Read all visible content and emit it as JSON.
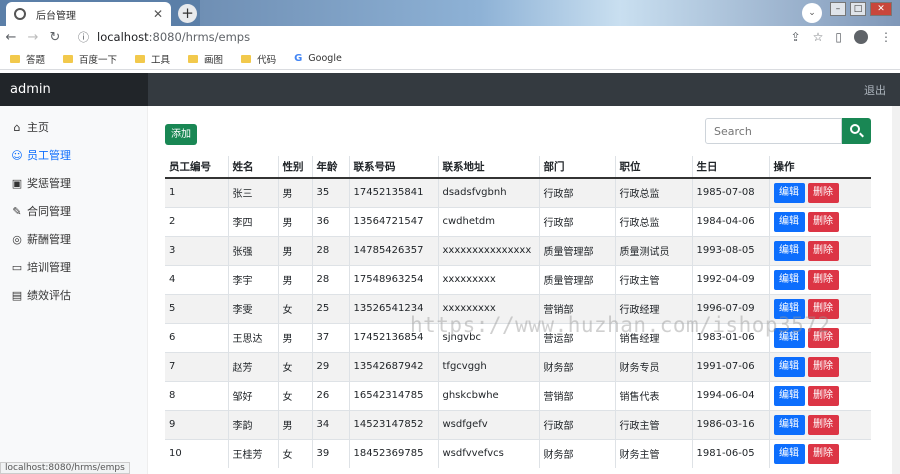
{
  "browser": {
    "tab_title": "后台管理",
    "tab_close": "✕",
    "new_tab": "+",
    "url_host": "localhost",
    "url_path": ":8080/hrms/emps",
    "bookmarks": [
      {
        "label": "答题",
        "icon": "folder-icon"
      },
      {
        "label": "百度一下",
        "icon": "folder-icon"
      },
      {
        "label": "工具",
        "icon": "folder-icon"
      },
      {
        "label": "画图",
        "icon": "folder-icon"
      },
      {
        "label": "代码",
        "icon": "folder-icon"
      },
      {
        "label": "Google",
        "icon": "google-icon"
      }
    ],
    "status_url": "localhost:8080/hrms/emps"
  },
  "navbar": {
    "brand": "admin",
    "logout": "退出"
  },
  "sidebar": {
    "items": [
      {
        "label": "主页",
        "icon": "home-icon",
        "glyph": "⌂"
      },
      {
        "label": "员工管理",
        "icon": "user-icon",
        "glyph": "☺"
      },
      {
        "label": "奖惩管理",
        "icon": "card-icon",
        "glyph": "▣"
      },
      {
        "label": "合同管理",
        "icon": "contract-icon",
        "glyph": "✎"
      },
      {
        "label": "薪酬管理",
        "icon": "money-icon",
        "glyph": "◎"
      },
      {
        "label": "培训管理",
        "icon": "training-icon",
        "glyph": "▭"
      },
      {
        "label": "绩效评估",
        "icon": "report-icon",
        "glyph": "▤"
      }
    ],
    "active_index": 1
  },
  "main": {
    "add_label": "添加",
    "search_placeholder": "Search",
    "columns": [
      "员工编号",
      "姓名",
      "性别",
      "年龄",
      "联系号码",
      "联系地址",
      "部门",
      "职位",
      "生日",
      "操作"
    ],
    "edit_label": "编辑",
    "delete_label": "删除",
    "rows": [
      [
        "1",
        "张三",
        "男",
        "35",
        "17452135841",
        "dsadsfvgbnh",
        "行政部",
        "行政总监",
        "1985-07-08"
      ],
      [
        "2",
        "李四",
        "男",
        "36",
        "13564721547",
        "cwdhetdm",
        "行政部",
        "行政总监",
        "1984-04-06"
      ],
      [
        "3",
        "张强",
        "男",
        "28",
        "14785426357",
        "xxxxxxxxxxxxxxx",
        "质量管理部",
        "质量测试员",
        "1993-08-05"
      ],
      [
        "4",
        "李宇",
        "男",
        "28",
        "17548963254",
        "xxxxxxxxx",
        "质量管理部",
        "行政主管",
        "1992-04-09"
      ],
      [
        "5",
        "李雯",
        "女",
        "25",
        "13526541234",
        "xxxxxxxxx",
        "营销部",
        "行政经理",
        "1996-07-09"
      ],
      [
        "6",
        "王思达",
        "男",
        "37",
        "17452136854",
        "sjngvbc",
        "营运部",
        "销售经理",
        "1983-01-06"
      ],
      [
        "7",
        "赵芳",
        "女",
        "29",
        "13542687942",
        "tfgcvggh",
        "财务部",
        "财务专员",
        "1991-07-06"
      ],
      [
        "8",
        "邹好",
        "女",
        "26",
        "16542314785",
        "ghskcbwhe",
        "营销部",
        "销售代表",
        "1994-06-04"
      ],
      [
        "9",
        "李韵",
        "男",
        "34",
        "14523147852",
        "wsdfgefv",
        "行政部",
        "行政主管",
        "1986-03-16"
      ],
      [
        "10",
        "王桂芳",
        "女",
        "39",
        "18452369785",
        "wsdfvvefvcs",
        "财务部",
        "财务主管",
        "1981-06-05"
      ]
    ]
  },
  "watermark": "https://www.huzhan.com/ishop3572"
}
